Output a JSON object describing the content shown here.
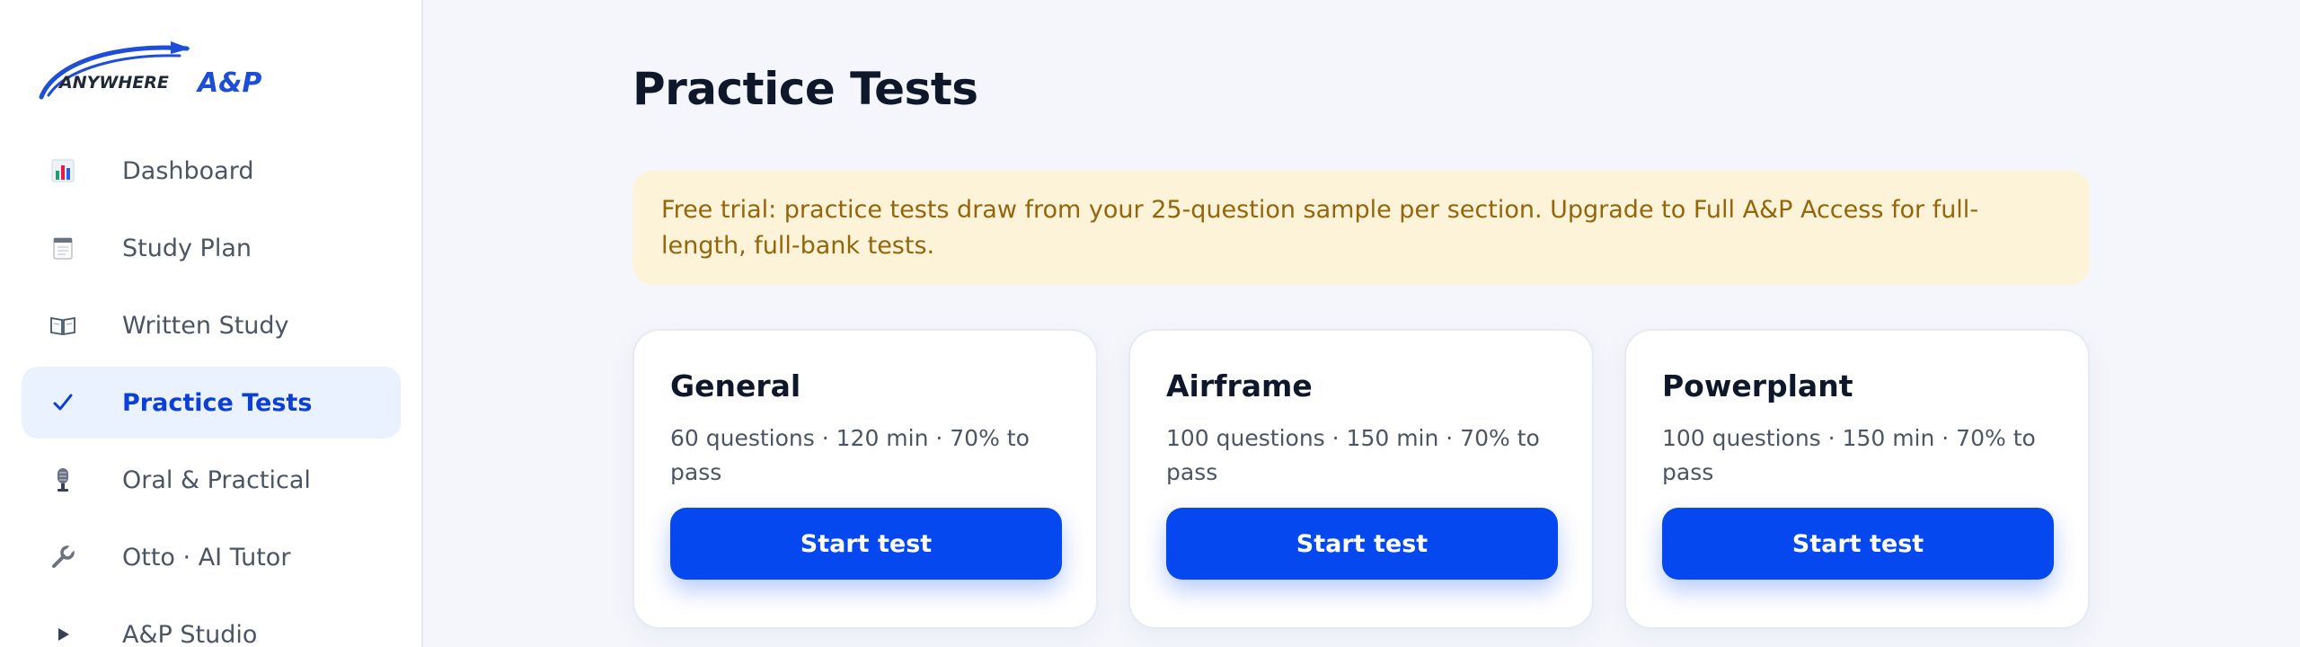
{
  "brand": {
    "logo_text_left": "ANYWHERE",
    "logo_text_right": "A&P",
    "colors": {
      "primary": "#0548f0",
      "dark": "#0f172a"
    }
  },
  "sidebar": {
    "items": [
      {
        "label": "Dashboard",
        "icon": "bar-chart-icon",
        "active": false
      },
      {
        "label": "Study Plan",
        "icon": "notepad-icon",
        "active": false
      },
      {
        "label": "Written Study",
        "icon": "open-book-icon",
        "active": false
      },
      {
        "label": "Practice Tests",
        "icon": "checkmark-icon",
        "active": true
      },
      {
        "label": "Oral & Practical",
        "icon": "microphone-icon",
        "active": false
      },
      {
        "label": "Otto · AI Tutor",
        "icon": "wrench-icon",
        "active": false
      },
      {
        "label": "A&P Studio",
        "icon": "play-icon",
        "active": false
      }
    ]
  },
  "main": {
    "title": "Practice Tests",
    "banner": "Free trial: practice tests draw from your 25-question sample per section. Upgrade to Full A&P Access for full-length, full-bank tests.",
    "cards": [
      {
        "title": "General",
        "meta": "60 questions · 120 min · 70% to pass",
        "button": "Start test"
      },
      {
        "title": "Airframe",
        "meta": "100 questions · 150 min · 70% to pass",
        "button": "Start test"
      },
      {
        "title": "Powerplant",
        "meta": "100 questions · 150 min · 70% to pass",
        "button": "Start test"
      }
    ]
  }
}
